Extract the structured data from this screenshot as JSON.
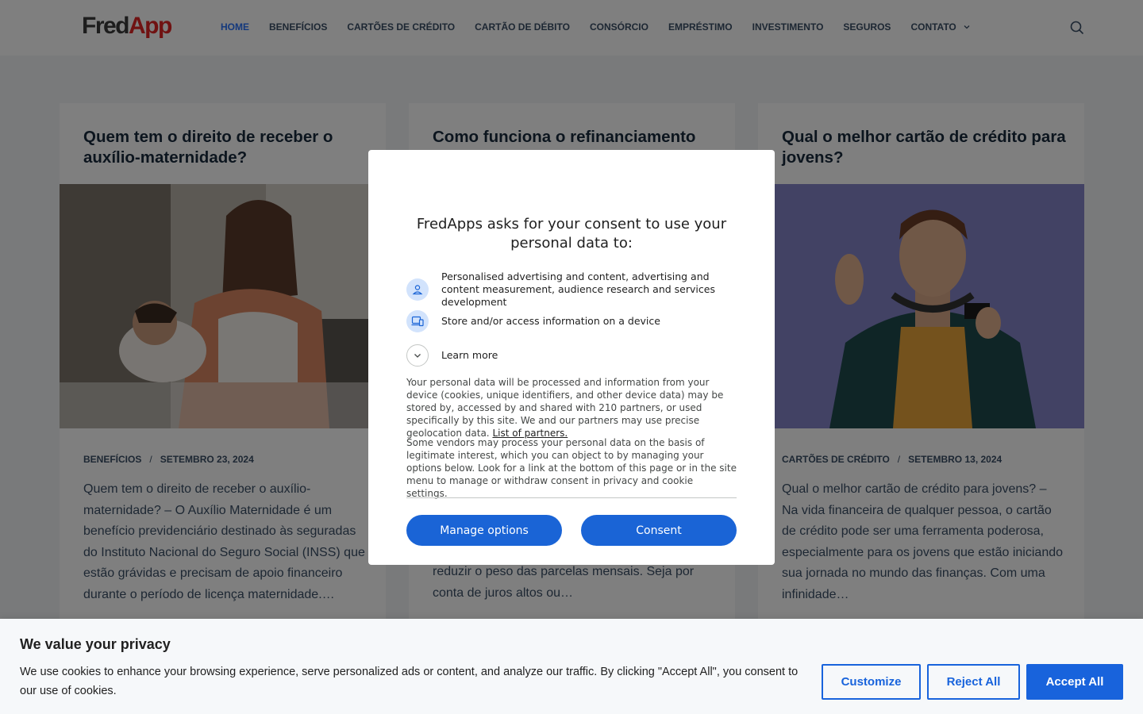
{
  "header": {
    "logo_part1": "Fred",
    "logo_part2": "App",
    "nav": [
      {
        "label": "HOME",
        "active": true
      },
      {
        "label": "BENEFÍCIOS"
      },
      {
        "label": "CARTÕES DE CRÉDITO"
      },
      {
        "label": "CARTÃO DE DÉBITO"
      },
      {
        "label": "CONSÓRCIO"
      },
      {
        "label": "EMPRÉSTIMO"
      },
      {
        "label": "INVESTIMENTO"
      },
      {
        "label": "SEGUROS"
      },
      {
        "label": "CONTATO",
        "has_dropdown": true
      }
    ],
    "search_icon": "search-icon"
  },
  "posts": [
    {
      "title": "Quem tem o direito de receber o auxílio-maternidade?",
      "category": "BENEFÍCIOS",
      "separator": "/",
      "date": "SETEMBRO 23, 2024",
      "excerpt": "Quem tem o direito de receber o auxílio-maternidade? – O Auxílio Maternidade é um benefício previdenciário destinado às seguradas do Instituto Nacional do Seguro Social (INSS) que estão grávidas e precisam de apoio financeiro durante o período de licença maternidade.…"
    },
    {
      "title": "Como funciona o refinanciamento de",
      "category": "",
      "separator": "",
      "date": "",
      "excerpt": "reduzir o peso das parcelas mensais. Seja por conta de juros altos ou…"
    },
    {
      "title": "Qual o melhor cartão de crédito para jovens?",
      "category": "CARTÕES DE CRÉDITO",
      "separator": "/",
      "date": "SETEMBRO 13, 2024",
      "excerpt": "Qual o melhor cartão de crédito para jovens? – Na vida financeira de qualquer pessoa, o cartão de crédito pode ser uma ferramenta poderosa, especialmente para os jovens que estão iniciando sua jornada no mundo das finanças. Com uma infinidade…"
    }
  ],
  "consent_dialog": {
    "title": "FredApps asks for your consent to use your personal data to:",
    "purposes": [
      {
        "icon": "person-icon",
        "text": "Personalised advertising and content, advertising and content measurement, audience research and services development"
      },
      {
        "icon": "devices-icon",
        "text": "Store and/or access information on a device"
      }
    ],
    "learn_more": "Learn more",
    "para1": "Your personal data will be processed and information from your device (cookies, unique identifiers, and other device data) may be stored by, accessed by and shared with 210 partners, or used specifically by this site. We and our partners may use precise geolocation data.",
    "partners_link": "List of partners.",
    "para2": "Some vendors may process your personal data on the basis of legitimate interest, which you can object to by managing your options below. Look for a link at the bottom of this page or in the site menu to manage or withdraw consent in privacy and cookie settings.",
    "manage_button": "Manage options",
    "consent_button": "Consent"
  },
  "cookie_bar": {
    "title": "We value your privacy",
    "text": "We use cookies to enhance your browsing experience, serve personalized ads or content, and analyze our traffic. By clicking \"Accept All\", you consent to our use of cookies.",
    "customize": "Customize",
    "reject": "Reject All",
    "accept": "Accept All"
  },
  "colors": {
    "accent": "#2872fa",
    "dialog_button": "#1a64d6",
    "cookie_button": "#1863dc",
    "logo_red": "#e02424"
  }
}
